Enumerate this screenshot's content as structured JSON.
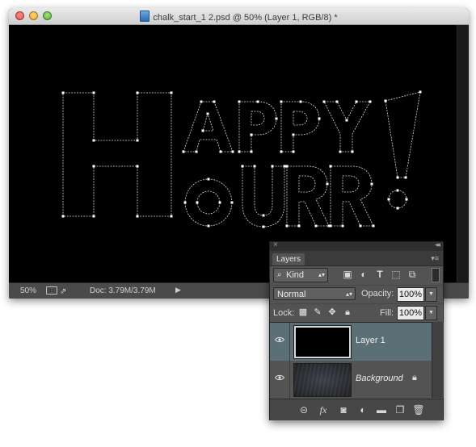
{
  "window": {
    "title": "chalk_start_1 2.psd @ 50% (Layer 1, RGB/8) *"
  },
  "status": {
    "zoom": "50%",
    "doc_size": "Doc: 3.79M/3.79M",
    "arrow": "▶"
  },
  "panel": {
    "close_glyph": "×",
    "collapse_glyph": "◂◂",
    "tab_label": "Layers",
    "menu_glyph": "▾≡",
    "filter_kind": "Kind",
    "filter_icons": [
      "image-filter-icon",
      "adjustment-filter-icon",
      "type-filter-icon",
      "shape-filter-icon",
      "smart-object-filter-icon"
    ],
    "blend_mode": "Normal",
    "opacity_label": "Opacity:",
    "opacity_value": "100%",
    "lock_label": "Lock:",
    "fill_label": "Fill:",
    "fill_value": "100%",
    "layers": [
      {
        "name": "Layer 1",
        "selected": true,
        "visible": true
      },
      {
        "name": "Background",
        "selected": false,
        "visible": true,
        "locked": true
      }
    ],
    "bottom_icons": [
      "link-layers-icon",
      "fx-icon",
      "add-mask-icon",
      "adjustment-layer-icon",
      "new-group-icon",
      "new-layer-icon",
      "delete-icon"
    ],
    "fx_glyph": "fx"
  },
  "colors": {
    "panel_bg": "#535353",
    "selected_layer": "#5b6f77",
    "canvas": "#000000",
    "path_stroke": "#d9d9d9"
  }
}
